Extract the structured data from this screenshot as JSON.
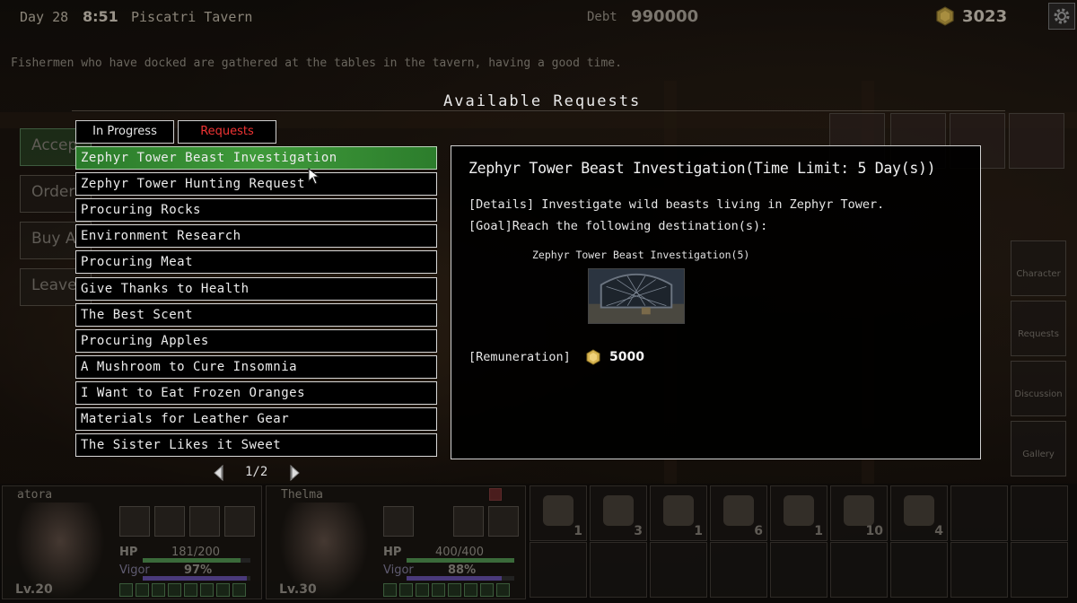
{
  "status_bar": {
    "day": "Day 28",
    "time": "8:51",
    "location": "Piscatri Tavern",
    "debt_label": "Debt",
    "debt_value": "990000",
    "gold": "3023"
  },
  "flavor_text": "Fishermen who have docked are gathered at the tables in the tavern, having a good time.",
  "left_menu": [
    "Accep",
    "Order",
    "Buy A",
    "Leave"
  ],
  "right_menu": [
    "Character",
    "Requests",
    "Discussion",
    "Gallery"
  ],
  "panel_title": "Available Requests",
  "tabs": {
    "in_progress": "In Progress",
    "requests": "Requests"
  },
  "requests": [
    "Zephyr Tower Beast Investigation",
    "Zephyr Tower Hunting Request",
    "Procuring Rocks",
    "Environment Research",
    "Procuring Meat",
    "Give Thanks to Health",
    "The Best Scent",
    "Procuring Apples",
    "A Mushroom to Cure Insomnia",
    "I Want to Eat Frozen Oranges",
    "Materials for Leather Gear",
    "The Sister Likes it Sweet"
  ],
  "selected_index": 0,
  "pager": {
    "text": "1/2"
  },
  "detail": {
    "title": "Zephyr Tower Beast Investigation(Time Limit: 5 Day(s))",
    "details": "[Details] Investigate wild beasts living in Zephyr Tower.",
    "goal": "[Goal]Reach the following destination(s):",
    "destination": "Zephyr Tower Beast Investigation(5)",
    "remuneration_label": "[Remuneration]",
    "remuneration_value": "5000"
  },
  "party": [
    {
      "name": "atora",
      "hp_label": "HP",
      "hp": "181/200",
      "hp_ratio": 0.905,
      "vigor_label": "Vigor",
      "vigor": "97%",
      "vigor_ratio": 0.97,
      "level": "Lv.20"
    },
    {
      "name": "Thelma",
      "hp_label": "HP",
      "hp": "400/400",
      "hp_ratio": 1.0,
      "vigor_label": "Vigor",
      "vigor": "88%",
      "vigor_ratio": 0.88,
      "level": "Lv.30"
    }
  ],
  "inventory": [
    {
      "icon": "shovel-icon",
      "count": "1"
    },
    {
      "icon": "hammer-icon",
      "count": "3"
    },
    {
      "icon": "key-icon",
      "count": "1"
    },
    {
      "icon": "herb-icon",
      "count": "6"
    },
    {
      "icon": "fish-icon",
      "count": "1"
    },
    {
      "icon": "bucket-icon",
      "count": "10"
    },
    {
      "icon": "bread-icon",
      "count": "4"
    }
  ]
}
